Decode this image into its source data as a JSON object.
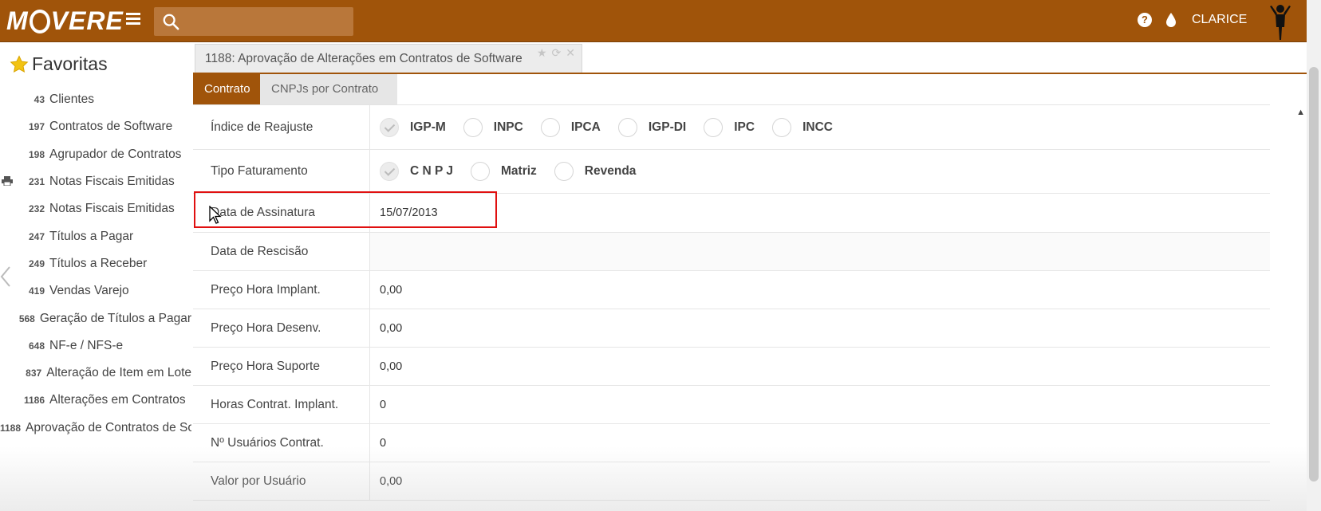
{
  "app": {
    "logo": "MOVERE",
    "user_name": "CLARICE",
    "brand_color": "#a0540a",
    "icons": [
      "menu-icon",
      "search-icon",
      "help-icon",
      "drop-icon",
      "avatar-figure-icon"
    ]
  },
  "search": {
    "placeholder": ""
  },
  "sidebar": {
    "title": "Favoritas",
    "items": [
      {
        "num": "43",
        "label": "Clientes"
      },
      {
        "num": "197",
        "label": "Contratos de Software"
      },
      {
        "num": "198",
        "label": "Agrupador de Contratos"
      },
      {
        "num": "231",
        "label": "Notas Fiscais Emitidas"
      },
      {
        "num": "232",
        "label": "Notas Fiscais Emitidas"
      },
      {
        "num": "247",
        "label": "Títulos a Pagar"
      },
      {
        "num": "249",
        "label": "Títulos a Receber"
      },
      {
        "num": "419",
        "label": "Vendas Varejo"
      },
      {
        "num": "568",
        "label": "Geração de Títulos a Pagar"
      },
      {
        "num": "648",
        "label": "NF-e / NFS-e"
      },
      {
        "num": "837",
        "label": "Alteração de Item em Lote"
      },
      {
        "num": "1186",
        "label": "Alterações em Contratos"
      },
      {
        "num": "1188",
        "label": "Aprovação de Contratos de Software"
      }
    ]
  },
  "main": {
    "doc_tab_title": "1188: Aprovação de Alterações em Contratos de Software",
    "tabs": [
      {
        "label": "Contrato",
        "active": true
      },
      {
        "label": "CNPJs por Contrato",
        "active": false
      }
    ],
    "form": {
      "indice_reajuste": {
        "label": "Índice de Reajuste",
        "options": [
          "IGP-M",
          "INPC",
          "IPCA",
          "IGP-DI",
          "IPC",
          "INCC"
        ],
        "selected": "IGP-M"
      },
      "tipo_faturamento": {
        "label": "Tipo Faturamento",
        "options": [
          "C N P J",
          "Matriz",
          "Revenda"
        ],
        "selected": "C N P J"
      },
      "data_assinatura": {
        "label": "Data de Assinatura",
        "value": "15/07/2013"
      },
      "data_rescisao": {
        "label": "Data de Rescisão",
        "value": ""
      },
      "preco_hora_implant": {
        "label": "Preço Hora Implant.",
        "value": "0,00"
      },
      "preco_hora_desenv": {
        "label": "Preço Hora Desenv.",
        "value": "0,00"
      },
      "preco_hora_suporte": {
        "label": "Preço Hora Suporte",
        "value": "0,00"
      },
      "horas_contrat_implant": {
        "label": "Horas Contrat. Implant.",
        "value": "0"
      },
      "n_usuarios_contrat": {
        "label": "Nº Usuários Contrat.",
        "value": "0"
      },
      "valor_por_usuario": {
        "label": "Valor por Usuário",
        "value": "0,00"
      }
    }
  },
  "annotation": {
    "highlight_color": "#e01010"
  }
}
